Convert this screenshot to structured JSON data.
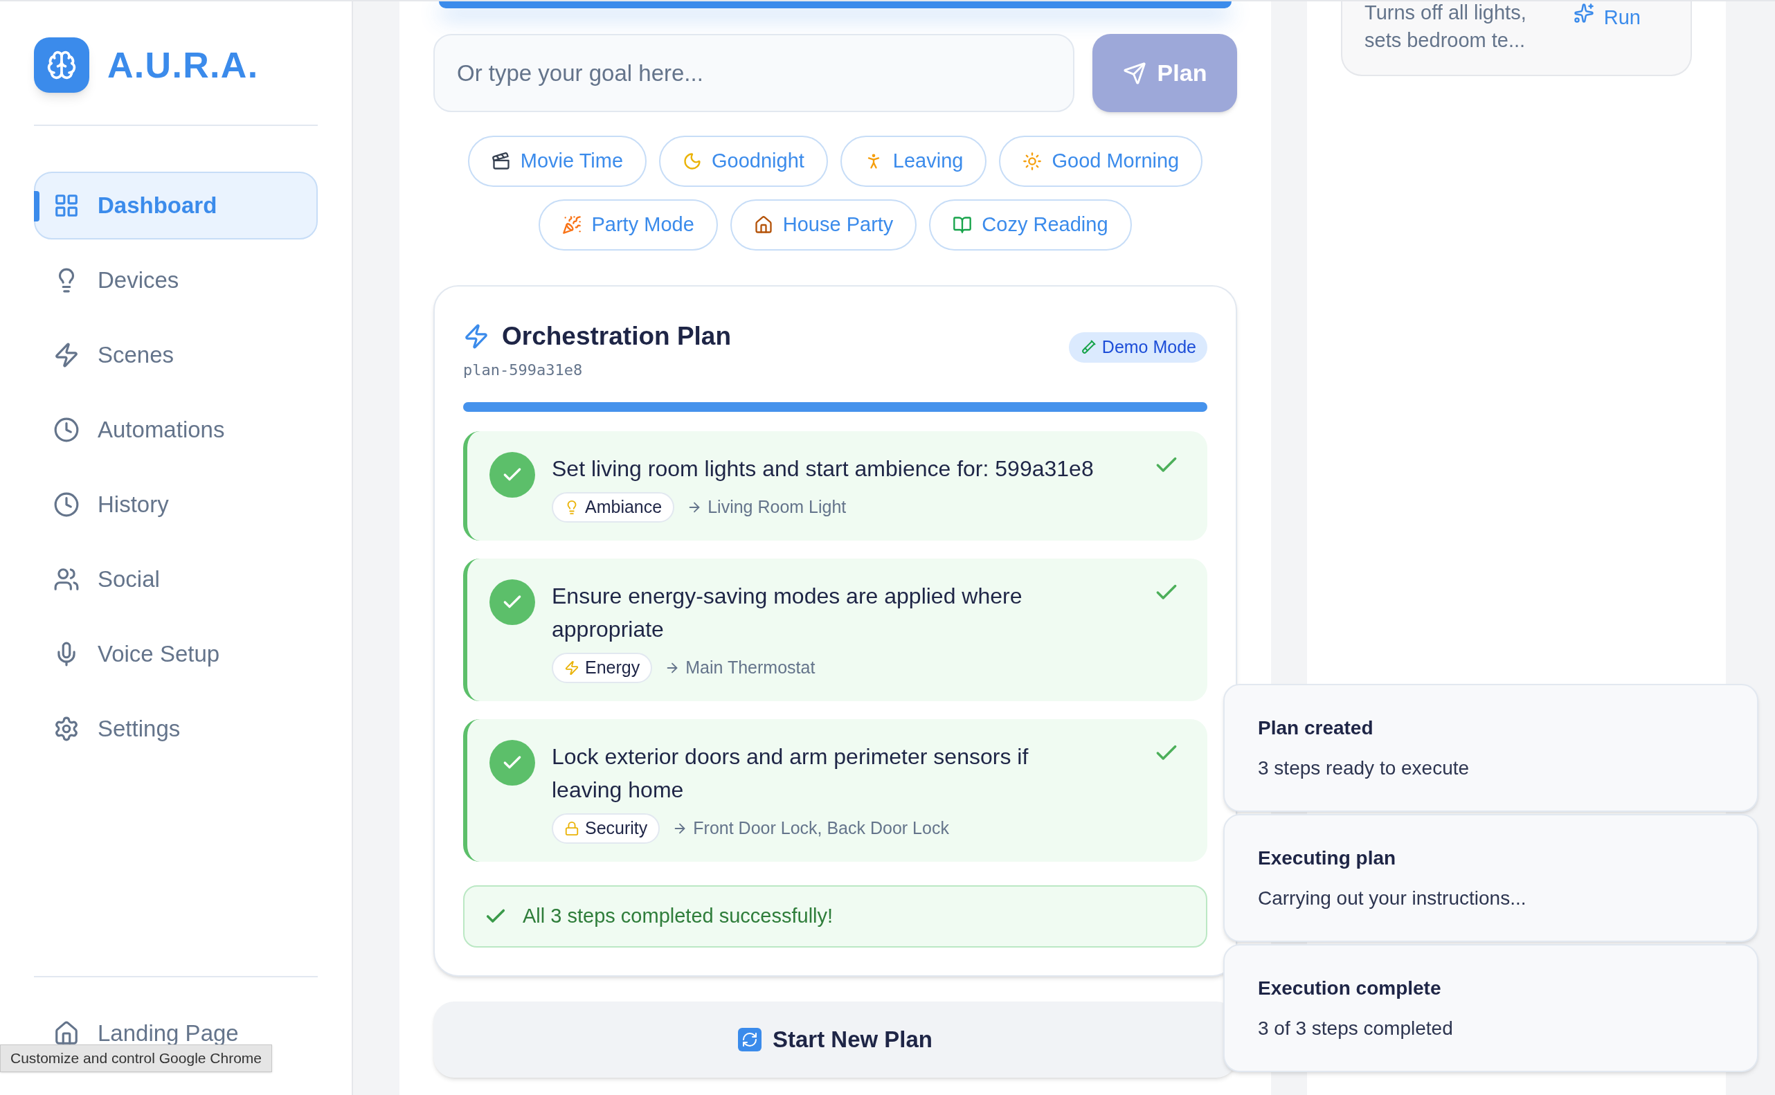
{
  "sidebar": {
    "logo": "A.U.R.A.",
    "items": [
      {
        "label": "Dashboard",
        "selected": true
      },
      {
        "label": "Devices",
        "selected": false
      },
      {
        "label": "Scenes",
        "selected": false
      },
      {
        "label": "Automations",
        "selected": false
      },
      {
        "label": "History",
        "selected": false
      },
      {
        "label": "Social",
        "selected": false
      },
      {
        "label": "Voice Setup",
        "selected": false
      },
      {
        "label": "Settings",
        "selected": false
      }
    ],
    "footer_items": [
      {
        "label": "Landing Page",
        "selected": false
      }
    ]
  },
  "goal_input": {
    "placeholder": "Or type your goal here..."
  },
  "plan_button": {
    "label": "Plan",
    "disabled": true
  },
  "quick_goals": [
    {
      "label": "Movie Time"
    },
    {
      "label": "Goodnight"
    },
    {
      "label": "Leaving"
    },
    {
      "label": "Good Morning"
    },
    {
      "label": "Party Mode"
    },
    {
      "label": "House Party"
    },
    {
      "label": "Cozy Reading"
    }
  ],
  "plan": {
    "title": "Orchestration Plan",
    "id": "plan-599a31e8",
    "badge": "Demo Mode",
    "level": 1,
    "steps": [
      {
        "title": "Set living room lights and start ambience for: 599a31e8",
        "done": true,
        "category": "Ambiance",
        "targets": "Living Room Light"
      },
      {
        "title": "Ensure energy-saving modes are applied where appropriate",
        "done": true,
        "category": "Energy",
        "targets": "Main Thermostat"
      },
      {
        "title": "Lock exterior doors and arm perimeter sensors if leaving home",
        "done": true,
        "category": "Security",
        "targets": "Front Door Lock, Back Door Lock"
      }
    ],
    "result": "All 3 steps completed successfully!"
  },
  "start_new_button": {
    "label": "Start New Plan"
  },
  "scene_card": {
    "description": "Turns off all lights, sets bedroom te...",
    "action": "Run"
  },
  "toasts": [
    {
      "title": "Plan created",
      "message": "3 steps ready to execute"
    },
    {
      "title": "Executing plan",
      "message": "Carrying out your instructions..."
    },
    {
      "title": "Execution complete",
      "message": "3 of 3 steps completed"
    }
  ],
  "tooltip": {
    "text": "Customize and control Google Chrome"
  }
}
